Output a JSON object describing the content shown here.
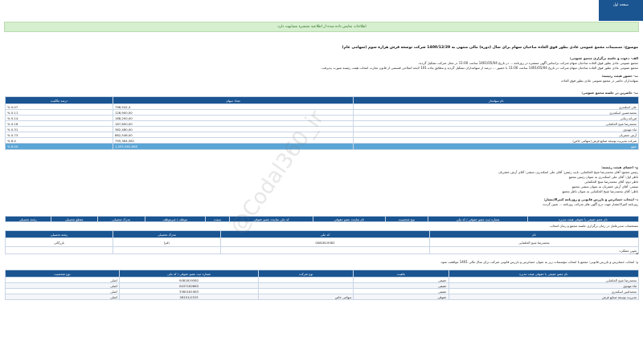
{
  "topbar": {
    "tab_label": "صفحه اول"
  },
  "alert": {
    "text": "اطلاعات نمایش داده شده از اطلاعیه منتشره مشابهت دارد."
  },
  "subject": "موضوع: تصمیمات مجمع عمومی عادی بطور فوق العاده صاحبان سهام برای سال (دوره) مالی منتهی به 1400/12/29 شرکت توسعه فرش هزاره سوم (سهامی عام)",
  "meeting": {
    "line1_label": "الف- دعوت و جلسه برگزاری مجمع عمومی:",
    "line1_text": "مجمع عمومی عادی بطور فوق العاده صاحبان سهام شرکت براساس آگهی منتشره در روزنامه ... در تاریخ 1401/05/04 ساعت 11:00 در محل شرکت تشکیل گردید.",
    "line2_text": "مجمع عمومی عادی بطور فوق العاده صاحبان سهام شرکت در تاریخ 1401/05/04 ساعت 11:00 با حضور ... درصد از سهامداران تشکیل گردید و مطابق ماده 101 لایحه اصلاحی قسمتی از قانون تجارت انتخاب هیئت رئیسه صورت پذیرفت.",
    "line3_label": "ب- حضور هیئت رئیسه:",
    "line3_text": "سهامداران حاضر در مجمع عمومی عادی بطور فوق العاده"
  },
  "holders": {
    "title": "ب- حاضرین در جلسه مجمع عمومی:",
    "headers": [
      "نام سهامدار",
      "تعداد سهام",
      "درصد مالکیت"
    ],
    "rows": [
      [
        "علی اسکندری",
        "796,542,4",
        "% 0.07"
      ],
      [
        "محمدحسین اسکندری",
        "128,900,00",
        "% 0.11"
      ],
      [
        "فرزانه زمانی",
        "168,200,00",
        "% 0.14"
      ],
      [
        "محمدرضا شیخ الحکمایی",
        "187,600,00",
        "% 0.16"
      ],
      [
        "ثناء مهدوی",
        "362,480,00",
        "% 0.31"
      ],
      [
        "آرش جعفریان",
        "862,546,00",
        "% 0.73"
      ],
      [
        "شرکت مدیریت توسعه صنایع فرش (سهامی خاص)",
        "795,384,581",
        "% 6.4"
      ]
    ],
    "total": [
      "جمع",
      "1,205,362,608",
      "% 8.00"
    ]
  },
  "agenda": {
    "line1_label": "ج- اعضای هیئت رئیسه:",
    "line1_text": "رئیس مجمع: آقای محمدرضا شیخ الحکمایی، نایب رئیس: آقای علی اسکندری، منشی: آقای آرش جعفریان",
    "item1": "ناظر اول: آقای علی اسکندری به عنوان رئیس مجمع",
    "item2": "ناظر دوم: آقای محمدرضا شیخ الحکمایی",
    "item3": "منشی: آقای آرش جعفریان به عنوان منشی مجمع",
    "item4": "ناظر: آقای محمدرضا شیخ الحکمایی به عنوان ناظر مجمع",
    "line2_label": "د- انتخاب حسابرس و بازرس قانونی و روزنامه کثیرالانتشار:",
    "line2_text": "روزنامه کثیرالانتشار جهت درج آگهی های شرکت روزنامه ... تعیین گردید."
  },
  "board": {
    "headers": [
      "نام عضو حقیقی یا حقوقی هیئت مدیره",
      "شماره ثبت عضو حقوقی / کد ملی",
      "نوع شخصیت",
      "نام نماینده عضو حقوقی",
      "کد ملی نماینده عضو حقوقی",
      "سمت",
      "موظف / غیرموظف",
      "مدرک تحصیلی",
      "مقطع تحصیلی",
      "رشته تحصیلی"
    ]
  },
  "ceo_section": {
    "title": "مشخصات مدیرعامل در زمان برگزاری جلسه مجمع و زمان انتخاب",
    "headers": [
      "نام",
      "کد ملی",
      "مدرک تحصیلی",
      "رشته تحصیلی"
    ],
    "row": [
      "محمدرضا شیخ الحکمایی",
      "0081819382",
      "دکترا",
      "بازرگانی"
    ],
    "extra_label": "تعیین عملکرد:"
  },
  "ceo_note": "هـ - ...",
  "auditor": {
    "title": "و- انتخاب حسابرس و بازرس قانونی: مجمع با انتخاب مؤسسات زیر به عنوان حسابرس و بازرس قانونی شرکت برای سال مالی 1401 موافقت نمود.",
    "headers": [
      "نام عضو حقیقی یا حقوقی هیئت مدیره",
      "ماهیت",
      "نوع شرکت",
      "شماره ثبت عضو حقوقی / کد ملی",
      "نوع شخصیت"
    ],
    "rows": [
      [
        "محمدرضا شیخ الحکمایی",
        "حقیقی",
        "",
        "0081819382",
        "اصلی"
      ],
      [
        "ثناء مهدوی",
        "حقیقی",
        "",
        "0437162683",
        "اصلی"
      ],
      [
        "محمدامین اسکندری",
        "حقیقی",
        "",
        "3360181983",
        "اصلی"
      ],
      [
        "مدیریت توسعه صنایع فرش",
        "حقوقی",
        "سهامی خاص",
        "28151/1323",
        "اصلی"
      ]
    ]
  },
  "watermark": "@Codal360_ir"
}
